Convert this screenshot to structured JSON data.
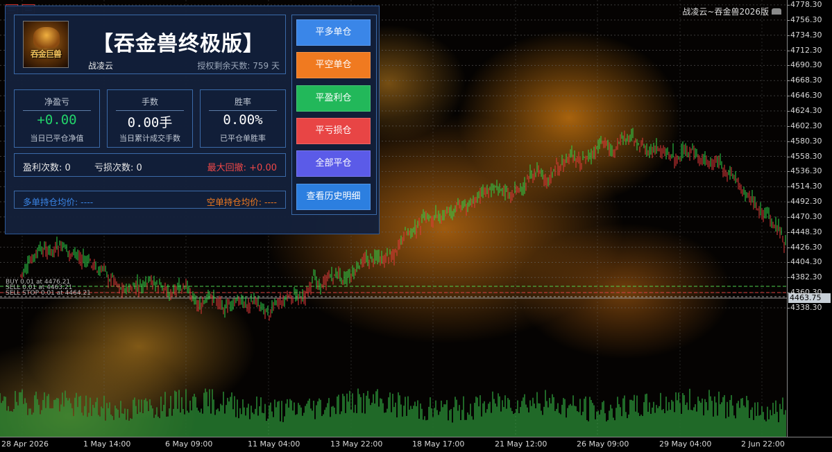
{
  "chart": {
    "title": "战凌云~吞金兽2026版",
    "order_labels": [
      "BUY 0.01 at 4476.21",
      "SELL 0.01 at 4463.21",
      "SELL STOP 0.01 at 4464.21"
    ],
    "current_price": "4463.75",
    "price_labels": [
      "4778.30",
      "4756.30",
      "4734.30",
      "4712.30",
      "4690.30",
      "4668.30",
      "4646.30",
      "4624.30",
      "4602.30",
      "4580.30",
      "4558.30",
      "4536.30",
      "4514.30",
      "4492.30",
      "4470.30",
      "4448.30",
      "4426.30",
      "4404.30",
      "4382.30",
      "4360.30",
      "4338.30"
    ],
    "time_labels": [
      "28 Apr 2026",
      "1 May 14:00",
      "6 May 09:00",
      "11 May 04:00",
      "13 May 22:00",
      "18 May 17:00",
      "21 May 12:00",
      "26 May 09:00",
      "29 May 04:00",
      "2 Jun 22:00"
    ]
  },
  "panel": {
    "logo_text": "吞金巨兽",
    "title": "【吞金兽终极版】",
    "author": "战凌云",
    "license": "授权剩余天数: 759 天",
    "stats": {
      "net": {
        "label": "净盈亏",
        "value": "+0.00",
        "sub": "当日已平仓净值"
      },
      "lots": {
        "label": "手数",
        "value": "0.00手",
        "sub": "当日累计成交手数"
      },
      "winrate": {
        "label": "胜率",
        "value": "0.00%",
        "sub": "已平仓单胜率"
      }
    },
    "win_count": "盈利次数: 0",
    "loss_count": "亏损次数: 0",
    "max_drawdown": "最大回撤: +0.00",
    "long_avg": "多单持仓均价: ----",
    "short_avg": "空单持仓均价: ----",
    "buttons": {
      "close_buy": "平多单仓",
      "close_sell": "平空单仓",
      "close_profit": "平盈利仓",
      "close_loss": "平亏损仓",
      "close_all": "全部平仓",
      "history": "查看历史明细"
    }
  },
  "colors": {
    "net_value": "#22d36a",
    "btn_close_buy": "#3a86e8",
    "btn_close_sell": "#f07a20",
    "btn_close_profit": "#22b85a",
    "btn_close_loss": "#e84545",
    "btn_close_all": "#5b5be8",
    "btn_history": "#2c7fe0"
  }
}
